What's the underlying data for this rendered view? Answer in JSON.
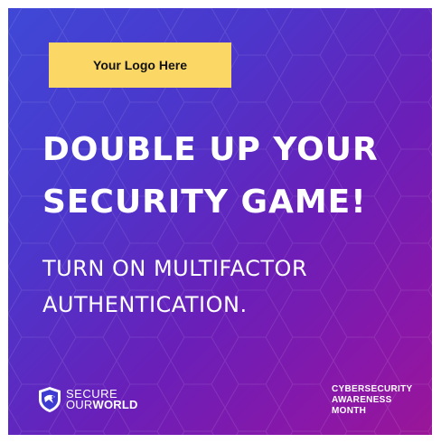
{
  "logo_placeholder": "Your Logo Here",
  "headline": {
    "line1": "DOUBLE UP YOUR",
    "line2": "SECURITY GAME!"
  },
  "subhead": {
    "line1": "TURN ON MULTIFACTOR",
    "line2": "AUTHENTICATION."
  },
  "brand": {
    "top": "SECURE",
    "bottom_prefix": "OUR",
    "bottom_bold": "WORLD",
    "icon": "shield-eagle-icon"
  },
  "campaign": {
    "line1": "CYBERSECURITY",
    "line2": "AWARENESS",
    "line3": "MONTH"
  },
  "colors": {
    "gradient_start": "#3f48d6",
    "gradient_end": "#9a1697",
    "logo_box": "#fbd765",
    "text": "#ffffff"
  }
}
